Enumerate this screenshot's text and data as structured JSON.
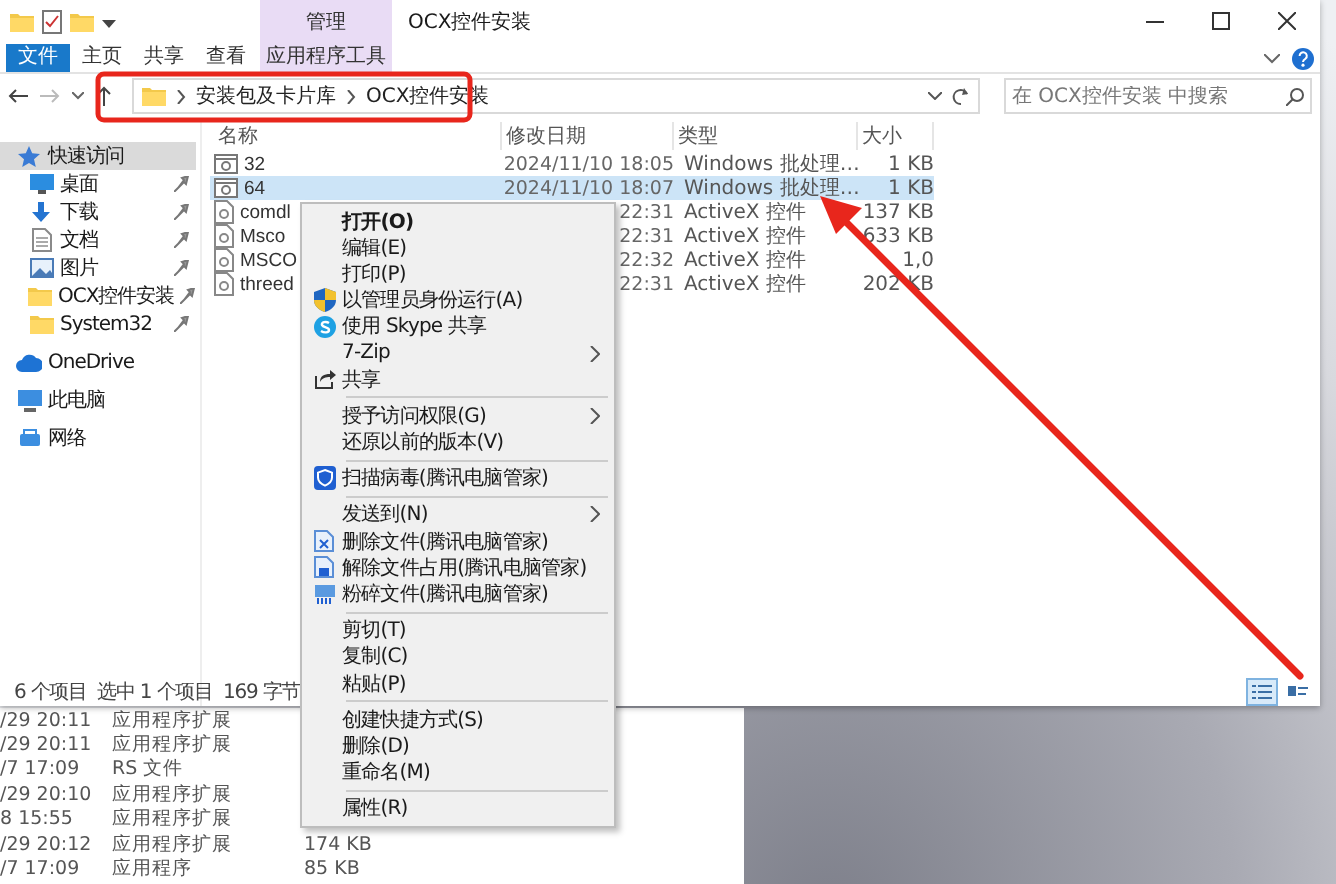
{
  "window": {
    "title": "OCX控件安装",
    "context_tab": "管理",
    "ribbon_tabs": [
      {
        "label": "文件",
        "selected": true
      },
      {
        "label": "主页",
        "selected": false
      },
      {
        "label": "共享",
        "selected": false
      },
      {
        "label": "查看",
        "selected": false
      },
      {
        "label": "应用程序工具",
        "selected": false
      }
    ],
    "address": {
      "path": [
        "安装包及卡片库",
        "OCX控件安装"
      ]
    },
    "search": {
      "placeholder": "在 OCX控件安装 中搜索"
    },
    "sidebar": {
      "items": [
        {
          "label": "快速访问",
          "selected": true,
          "pinned": false
        },
        {
          "label": "桌面",
          "selected": false,
          "pinned": true
        },
        {
          "label": "下载",
          "selected": false,
          "pinned": true
        },
        {
          "label": "文档",
          "selected": false,
          "pinned": true
        },
        {
          "label": "图片",
          "selected": false,
          "pinned": true
        },
        {
          "label": "OCX控件安装",
          "selected": false,
          "pinned": true
        },
        {
          "label": "System32",
          "selected": false,
          "pinned": true
        },
        {
          "label": "OneDrive",
          "selected": false,
          "pinned": false
        },
        {
          "label": "此电脑",
          "selected": false,
          "pinned": false
        },
        {
          "label": "网络",
          "selected": false,
          "pinned": false
        }
      ]
    },
    "columns": [
      "名称",
      "修改日期",
      "类型",
      "大小"
    ],
    "rows": [
      {
        "kind": "batch",
        "name": "32",
        "date": "2024/11/10 18:05",
        "type": "Windows 批处理…",
        "size": "1 KB",
        "selected": false
      },
      {
        "kind": "batch",
        "name": "64",
        "date": "2024/11/10 18:07",
        "type": "Windows 批处理…",
        "size": "1 KB",
        "selected": true
      },
      {
        "kind": "activex",
        "name": "comdl",
        "date": "22:31",
        "type": "ActiveX 控件",
        "size": "137 KB",
        "selected": false
      },
      {
        "kind": "activex",
        "name": "Msco",
        "date": "22:31",
        "type": "ActiveX 控件",
        "size": "633 KB",
        "selected": false
      },
      {
        "kind": "activex",
        "name": "MSCO",
        "date": "22:32",
        "type": "ActiveX 控件",
        "size": "1,0",
        "selected": false
      },
      {
        "kind": "activex",
        "name": "threed",
        "date": "22:31",
        "type": "ActiveX 控件",
        "size": "202 KB",
        "selected": false
      }
    ],
    "status_bar": {
      "count": "6 个项目",
      "selection": "选中 1 个项目",
      "bytes": "169 字节"
    },
    "view_buttons": [
      {
        "kind": "details",
        "selected": true
      },
      {
        "kind": "tiles",
        "selected": false
      }
    ]
  },
  "context_menu": {
    "items": [
      {
        "kind": "default",
        "label": "打开(O)"
      },
      {
        "kind": "item",
        "label": "编辑(E)"
      },
      {
        "kind": "item",
        "label": "打印(P)"
      },
      {
        "kind": "item",
        "label": "以管理员身份运行(A)"
      },
      {
        "kind": "item",
        "label": "使用 Skype 共享"
      },
      {
        "kind": "submenu",
        "label": "7-Zip"
      },
      {
        "kind": "item",
        "label": "共享"
      },
      {
        "kind": "separator"
      },
      {
        "kind": "submenu",
        "label": "授予访问权限(G)"
      },
      {
        "kind": "item",
        "label": "还原以前的版本(V)"
      },
      {
        "kind": "separator"
      },
      {
        "kind": "item",
        "label": "扫描病毒(腾讯电脑管家)"
      },
      {
        "kind": "separator"
      },
      {
        "kind": "submenu",
        "label": "发送到(N)"
      },
      {
        "kind": "item",
        "label": "删除文件(腾讯电脑管家)"
      },
      {
        "kind": "item",
        "label": "解除文件占用(腾讯电脑管家)"
      },
      {
        "kind": "item",
        "label": "粉碎文件(腾讯电脑管家)"
      },
      {
        "kind": "separator"
      },
      {
        "kind": "item",
        "label": "剪切(T)"
      },
      {
        "kind": "item",
        "label": "复制(C)"
      },
      {
        "kind": "item",
        "label": "粘贴(P)"
      },
      {
        "kind": "separator"
      },
      {
        "kind": "item",
        "label": "创建快捷方式(S)"
      },
      {
        "kind": "item",
        "label": "删除(D)"
      },
      {
        "kind": "item",
        "label": "重命名(M)"
      },
      {
        "kind": "separator"
      },
      {
        "kind": "item",
        "label": "属性(R)"
      }
    ]
  },
  "background_window": {
    "rows": [
      {
        "date": "/29 20:11",
        "type": "应用程序扩展"
      },
      {
        "date": "/29 20:11",
        "type": "应用程序扩展"
      },
      {
        "date": "/7 17:09",
        "type": "RS 文件"
      },
      {
        "date": "/29 20:10",
        "type": "应用程序扩展"
      },
      {
        "date": "8 15:55",
        "type": "应用程序扩展"
      },
      {
        "date": "/29 20:12",
        "type": "应用程序扩展",
        "size": "174 KB"
      },
      {
        "date": "/7 17:09",
        "type": "应用程序",
        "size": "85 KB"
      }
    ]
  }
}
